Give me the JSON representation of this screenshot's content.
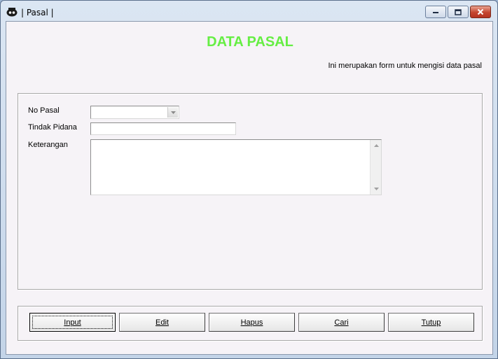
{
  "window": {
    "title": "| Pasal |",
    "icon": "app-logo-icon"
  },
  "header": {
    "title": "DATA PASAL",
    "title_color": "#66ee44",
    "subtitle": "Ini merupakan form untuk mengisi data pasal"
  },
  "fields": {
    "no_pasal_label": "No Pasal",
    "no_pasal_value": "",
    "tindak_pidana_label": "Tindak Pidana",
    "tindak_pidana_value": "",
    "keterangan_label": "Keterangan",
    "keterangan_value": ""
  },
  "buttons": {
    "input": "Input",
    "edit": "Edit",
    "hapus": "Hapus",
    "cari": "Cari",
    "tutup": "Tutup"
  }
}
